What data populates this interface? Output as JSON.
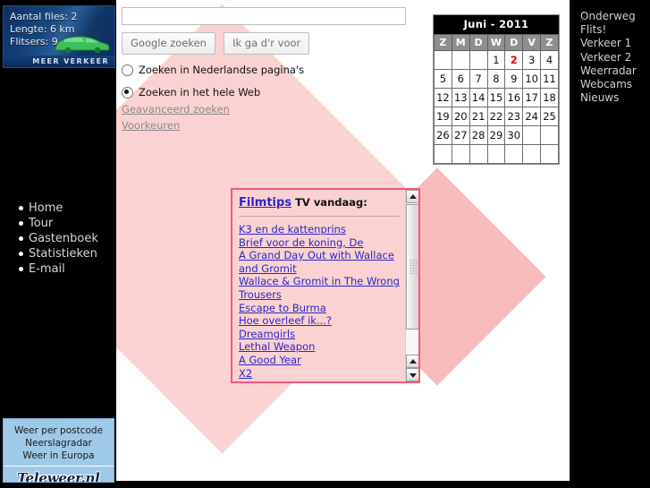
{
  "traffic_widget": {
    "lines": [
      "Aantal files: 2",
      "Lengte: 6 km",
      "Flitsers: 9"
    ],
    "footer_label": "MEER VERKEER",
    "icon": "green-car-icon",
    "bg_color": "#0a2b5e",
    "car_color": "#3fbf5a"
  },
  "left_nav": {
    "items": [
      {
        "label": "Home"
      },
      {
        "label": "Tour"
      },
      {
        "label": "Gastenboek"
      },
      {
        "label": "Statistieken"
      },
      {
        "label": "E-mail"
      }
    ]
  },
  "weather_widget": {
    "links": [
      "Weer per postcode",
      "Neerslagradar",
      "Weer in Europa"
    ],
    "logo": "Teleweer.nl",
    "bg_color": "#9ec9e8"
  },
  "search": {
    "value": "",
    "placeholder": "",
    "submit_label": "Google zoeken",
    "lucky_label": "Ik ga d'r voor",
    "scope_options": [
      {
        "label": "Zoeken in Nederlandse pagina's",
        "selected": false
      },
      {
        "label": "Zoeken in het hele Web",
        "selected": true
      }
    ],
    "links": [
      "Geavanceerd zoeken",
      "Voorkeuren"
    ]
  },
  "calendar": {
    "title": "Juni - 2011",
    "weekday_headers": [
      "Z",
      "M",
      "D",
      "W",
      "D",
      "V",
      "Z"
    ],
    "today": 2,
    "today_color": "#e50000",
    "weeks": [
      [
        "",
        "",
        "",
        "1",
        "2",
        "3",
        "4"
      ],
      [
        "5",
        "6",
        "7",
        "8",
        "9",
        "10",
        "11"
      ],
      [
        "12",
        "13",
        "14",
        "15",
        "16",
        "17",
        "18"
      ],
      [
        "19",
        "20",
        "21",
        "22",
        "23",
        "24",
        "25"
      ],
      [
        "26",
        "27",
        "28",
        "29",
        "30",
        "",
        ""
      ],
      [
        "",
        "",
        "",
        "",
        "",
        "",
        ""
      ]
    ]
  },
  "film_panel": {
    "heading_link": "Filmtips",
    "heading_rest": " TV vandaag:",
    "border_color": "#f05a78",
    "bg_color": "#fbd2d2",
    "link_color": "#2a27c8",
    "films": [
      "K3 en de kattenprins",
      "Brief voor de koning, De",
      "A Grand Day Out with Wallace and Gromit",
      "Wallace & Gromit in The Wrong Trousers",
      "Escape to Burma",
      "Hoe overleef ik...?",
      "Dreamgirls",
      "Lethal Weapon",
      "A Good Year",
      "X2"
    ],
    "scrollbar": {
      "up_arrow": "▲",
      "down_arrow": "▼"
    }
  },
  "right_nav": {
    "items": [
      {
        "label": "Onderweg"
      },
      {
        "label": "Flits!"
      },
      {
        "label": "Verkeer 1"
      },
      {
        "label": "Verkeer 2"
      },
      {
        "label": "Weerradar"
      },
      {
        "label": "Webcams"
      },
      {
        "label": "Nieuws"
      }
    ]
  },
  "background": {
    "page_bg": "#000000",
    "content_bg": "#ffffff",
    "diamond_color": "#fbd2d2",
    "diamond_overlap_color": "#f9bcbc"
  }
}
